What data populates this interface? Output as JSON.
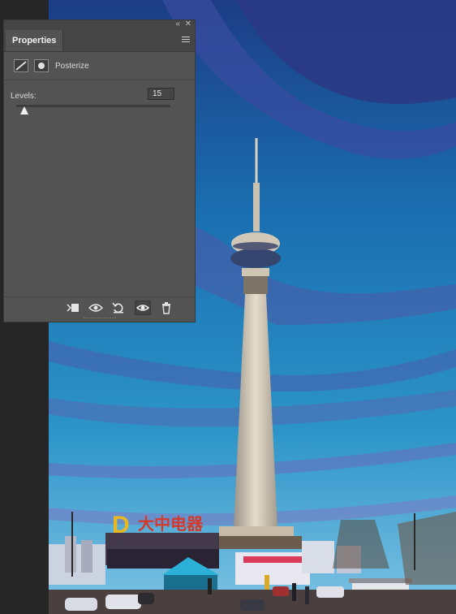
{
  "panel": {
    "tab_label": "Properties",
    "adjustment_name": "Posterize",
    "levels_label": "Levels:",
    "levels_value": "15",
    "levels_slider_fraction": 0.05
  },
  "canvas_signs": {
    "store_logo": "D",
    "store_name": "大中电器"
  },
  "colors": {
    "panel_bg": "#535353",
    "accent_sign": "#e8b820"
  },
  "icons": [
    "collapse-icon",
    "close-icon",
    "panel-menu-icon",
    "adjustment-layer-icon",
    "mask-icon",
    "clip-to-layer-icon",
    "view-previous-state-icon",
    "reset-icon",
    "visibility-eye-icon",
    "trash-icon"
  ]
}
